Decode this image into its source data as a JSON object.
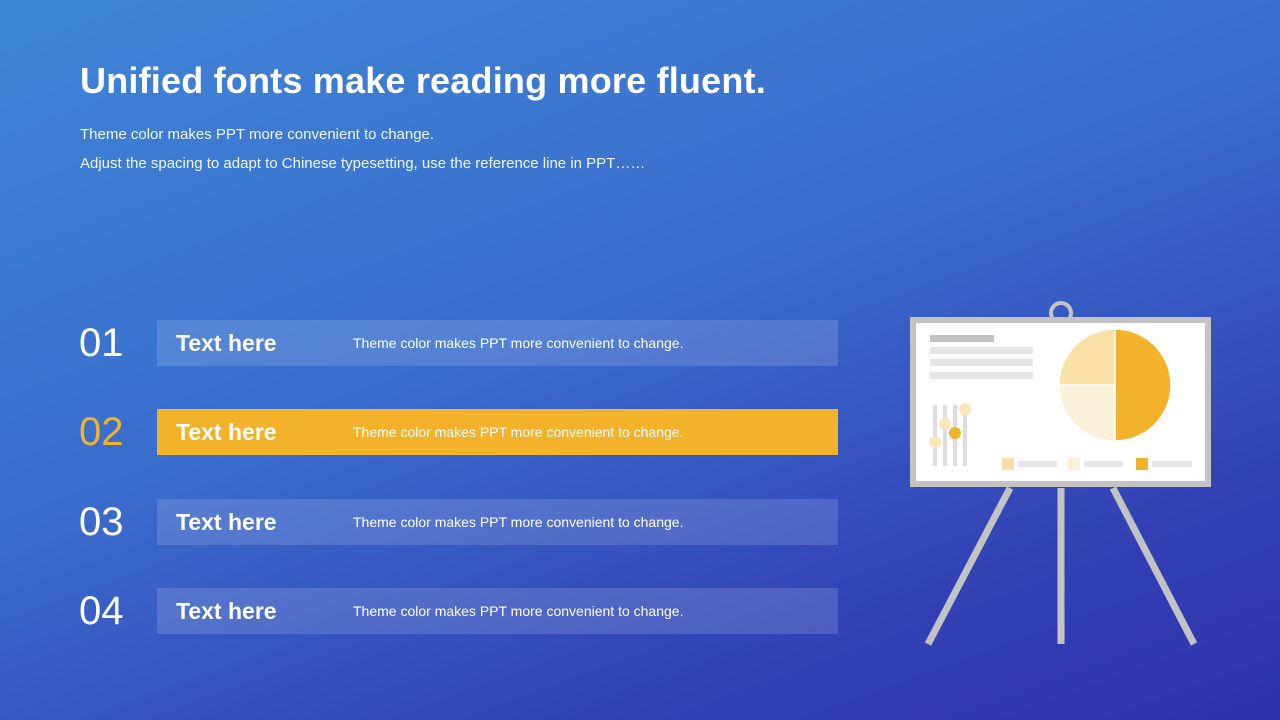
{
  "header": {
    "title": "Unified fonts make reading more fluent.",
    "subtitle_1": "Theme color makes PPT more convenient to change.",
    "subtitle_2": "Adjust the spacing to adapt to Chinese typesetting, use the reference line in PPT……"
  },
  "items": [
    {
      "number": "01",
      "title": "Text here",
      "description": "Theme  color makes  PPT more convenient  to change.",
      "highlighted": false
    },
    {
      "number": "02",
      "title": "Text here",
      "description": "Theme  color makes  PPT more convenient  to change.",
      "highlighted": true
    },
    {
      "number": "03",
      "title": "Text here",
      "description": "Theme  color makes  PPT more convenient  to change.",
      "highlighted": false
    },
    {
      "number": "04",
      "title": "Text here",
      "description": "Theme  color makes  PPT more convenient  to change.",
      "highlighted": false
    }
  ],
  "illustration": {
    "icon": "presentation-easel-icon",
    "pie_slices": [
      {
        "fraction": 0.5,
        "color": "#f2b22a"
      },
      {
        "fraction": 0.25,
        "color": "#fbf0d8"
      },
      {
        "fraction": 0.25,
        "color": "#fadfa6"
      }
    ]
  },
  "colors": {
    "accent": "#f2b22a",
    "background_start": "#3f86d8",
    "background_end": "#2f33ad",
    "easel_frame": "#c3c3c3"
  }
}
